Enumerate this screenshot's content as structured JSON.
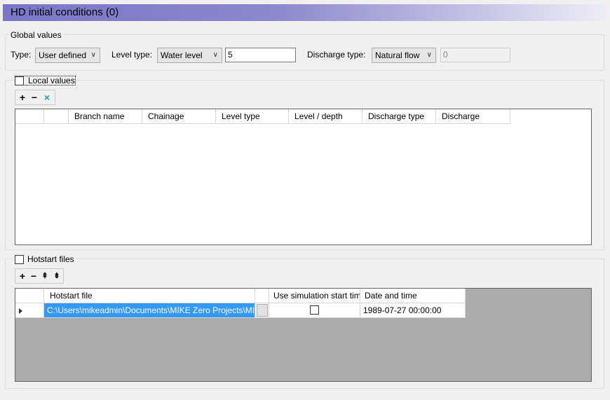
{
  "window": {
    "title": "HD initial conditions (0)"
  },
  "global_values": {
    "legend": "Global values",
    "type_label": "Type:",
    "type_value": "User defined",
    "level_type_label": "Level type:",
    "level_type_value": "Water level",
    "level_value": "5",
    "discharge_type_label": "Discharge type:",
    "discharge_type_value": "Natural flow",
    "discharge_value": "0"
  },
  "local_values": {
    "legend": "Local values",
    "checked": false,
    "toolbar": {
      "add": "+",
      "remove": "−",
      "delete": "×"
    },
    "columns": [
      "",
      "",
      "Branch name",
      "Chainage",
      "Level type",
      "Level / depth",
      "Discharge type",
      "Discharge"
    ]
  },
  "hotstart": {
    "legend": "Hotstart files",
    "checked": false,
    "toolbar": {
      "add": "+",
      "remove": "−",
      "up": "⇞",
      "down": "⇟"
    },
    "columns": [
      "",
      "Hotstart file",
      "",
      "Use simulation start time",
      "Date and time"
    ],
    "rows": [
      {
        "file": "C:\\Users\\mikeadmin\\Documents\\MIKE Zero Projects\\MIK...",
        "use_sim_start": false,
        "datetime": "1989-07-27 00:00:00"
      }
    ]
  },
  "icons": {
    "dropdown": "chevron-down-icon",
    "row_indicator": "triangle-right-icon"
  }
}
